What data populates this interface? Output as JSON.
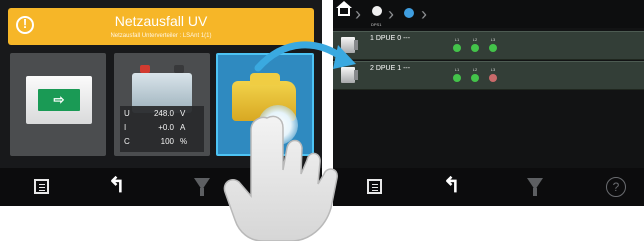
{
  "left_screen": {
    "banner": {
      "title": "Netzausfall UV",
      "subtitle": "Netzausfall Unterverteiler : LSAnt 1(1)",
      "color": "#f6b628"
    },
    "tiles": [
      {
        "name": "exit-sign",
        "icon": "exit-sign-icon"
      },
      {
        "name": "battery",
        "icon": "battery-icon"
      },
      {
        "name": "output-modules",
        "icon": "output-module-icon",
        "selected": true
      }
    ],
    "battery_readout": [
      {
        "symbol": "U",
        "value": "248.0",
        "unit": "V"
      },
      {
        "symbol": "I",
        "value": "+0.0",
        "unit": "A"
      },
      {
        "symbol": "C",
        "value": "100",
        "unit": "%"
      }
    ]
  },
  "right_screen": {
    "breadcrumb": [
      {
        "icon": "home-icon"
      },
      {
        "icon": "device-icon",
        "label": "DPS1"
      },
      {
        "icon": "device-icon-active"
      }
    ],
    "rows": [
      {
        "label": "1 DPUE 0 ---",
        "phases": [
          {
            "name": "L1",
            "status": "on"
          },
          {
            "name": "L2",
            "status": "on"
          },
          {
            "name": "L3",
            "status": "on"
          }
        ]
      },
      {
        "label": "2 DPUE 1 ---",
        "phases": [
          {
            "name": "L1",
            "status": "on"
          },
          {
            "name": "L2",
            "status": "on"
          },
          {
            "name": "L3",
            "status": "fault"
          }
        ]
      }
    ]
  },
  "toolbar": {
    "items": [
      "menu-icon",
      "back-arrow-icon",
      "filter-icon",
      "help-icon"
    ],
    "help_label": "?"
  },
  "colors": {
    "led_on": "#43c34a",
    "led_fault": "#c96a6a",
    "accent": "#3aa9e0"
  }
}
